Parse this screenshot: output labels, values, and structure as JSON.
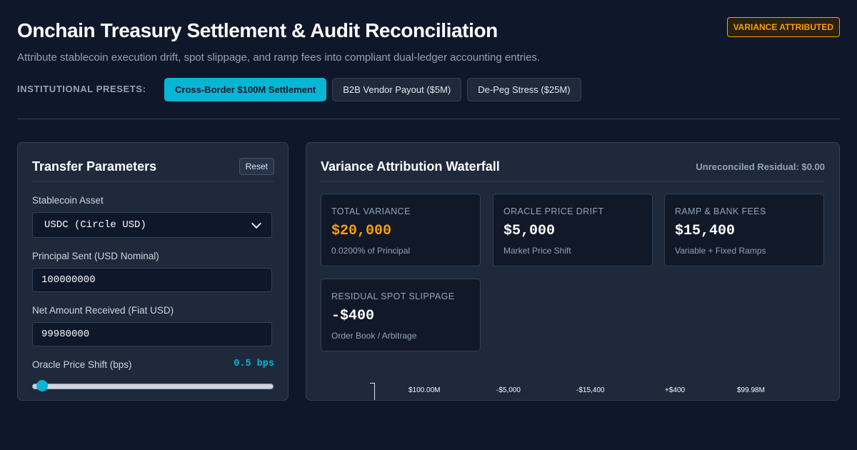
{
  "header": {
    "title": "Onchain Treasury Settlement & Audit Reconciliation",
    "subtitle": "Attribute stablecoin execution drift, spot slippage, and ramp fees into compliant dual-ledger accounting entries.",
    "status_badge": "VARIANCE ATTRIBUTED"
  },
  "presets": {
    "label": "INSTITUTIONAL PRESETS:",
    "items": [
      {
        "label": "Cross-Border $100M Settlement",
        "active": true
      },
      {
        "label": "B2B Vendor Payout ($5M)",
        "active": false
      },
      {
        "label": "De-Peg Stress ($25M)",
        "active": false
      }
    ]
  },
  "params": {
    "title": "Transfer Parameters",
    "reset_label": "Reset",
    "asset_label": "Stablecoin Asset",
    "asset_value": "USDC (Circle USD)",
    "principal_label": "Principal Sent (USD Nominal)",
    "principal_value": "100000000",
    "net_label": "Net Amount Received (Fiat USD)",
    "net_value": "99980000",
    "oracle_label": "Oracle Price Shift (bps)",
    "oracle_value": "0.5 bps",
    "oracle_level": 0.03
  },
  "waterfall": {
    "title": "Variance Attribution Waterfall",
    "residual": "Unreconciled Residual: $0.00",
    "cards": [
      {
        "label": "TOTAL VARIANCE",
        "value": "$20,000",
        "sub": "0.0200% of Principal",
        "accent": "#f59e0b"
      },
      {
        "label": "ORACLE PRICE DRIFT",
        "value": "$5,000",
        "sub": "Market Price Shift"
      },
      {
        "label": "RAMP & BANK FEES",
        "value": "$15,400",
        "sub": "Variable + Fixed Ramps"
      },
      {
        "label": "RESIDUAL SPOT SLIPPAGE",
        "value": "-$400",
        "sub": "Order Book / Arbitrage"
      }
    ],
    "bar_labels": [
      "$100.00M",
      "-$5,000",
      "-$15,400",
      "+$400",
      "$99.98M"
    ]
  }
}
